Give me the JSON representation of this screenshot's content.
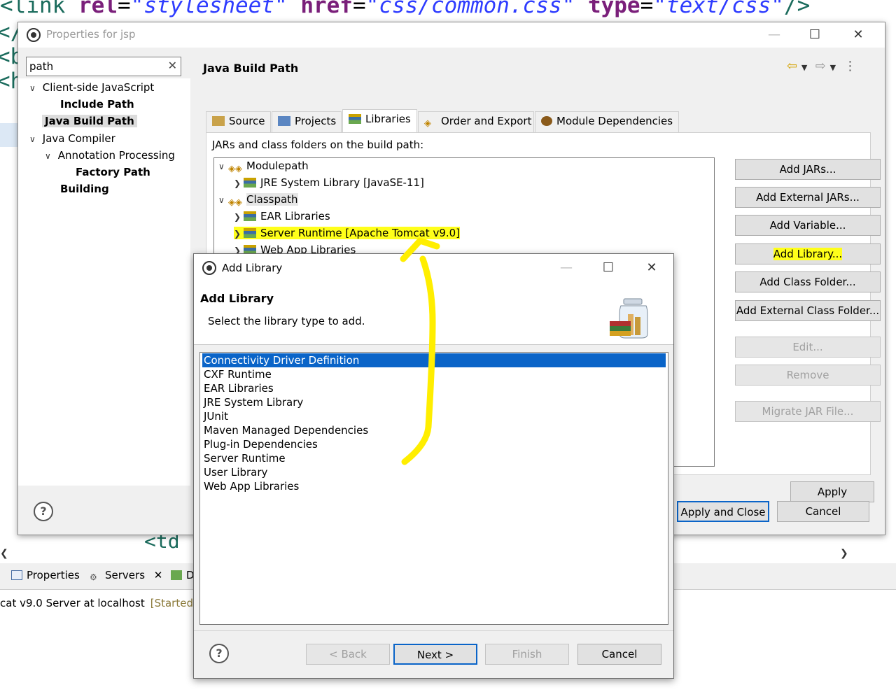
{
  "editor": {
    "code_parts": [
      "<",
      "link",
      " ",
      "rel",
      "=",
      "\"stylesheet\"",
      " ",
      "href",
      "=",
      "\"css/common.css\"",
      " ",
      "type",
      "=",
      "\"text/css\"",
      "/>"
    ],
    "left_glyphs": [
      "</",
      "<b",
      "<h"
    ],
    "td_fragment": "<td"
  },
  "properties_window": {
    "title": "Properties for jsp",
    "filter_value": "path",
    "left_tree": [
      {
        "label": "Client-side JavaScript",
        "expanded": true
      },
      {
        "label": "Include Path"
      },
      {
        "label": "Java Build Path",
        "selected": true
      },
      {
        "label": "Java Compiler",
        "expanded": true
      },
      {
        "label": "Annotation Processing",
        "expanded": true
      },
      {
        "label": "Factory Path"
      },
      {
        "label": "Building"
      }
    ],
    "page_title": "Java Build Path",
    "tabs": [
      {
        "label": "Source"
      },
      {
        "label": "Projects"
      },
      {
        "label": "Libraries",
        "active": true
      },
      {
        "label": "Order and Export"
      },
      {
        "label": "Module Dependencies"
      }
    ],
    "jars_label": "JARs and class folders on the build path:",
    "build_tree": [
      {
        "label": "Modulepath"
      },
      {
        "label": "JRE System Library [JavaSE-11]"
      },
      {
        "label": "Classpath"
      },
      {
        "label": "EAR Libraries"
      },
      {
        "label": "Server Runtime [Apache Tomcat v9.0]",
        "highlighted": true
      },
      {
        "label": "Web App Libraries"
      }
    ],
    "side_buttons": [
      {
        "label": "Add JARs...",
        "enabled": true
      },
      {
        "label": "Add External JARs...",
        "enabled": true
      },
      {
        "label": "Add Variable...",
        "enabled": true
      },
      {
        "label": "Add Library...",
        "enabled": true,
        "highlighted": true
      },
      {
        "label": "Add Class Folder...",
        "enabled": true
      },
      {
        "label": "Add External Class Folder...",
        "enabled": true
      },
      {
        "label": "Edit...",
        "enabled": false
      },
      {
        "label": "Remove",
        "enabled": false
      },
      {
        "label": "Migrate JAR File...",
        "enabled": false
      }
    ],
    "apply_label": "Apply",
    "apply_close_label": "Apply and Close",
    "cancel_label": "Cancel"
  },
  "add_library": {
    "title": "Add Library",
    "heading": "Add Library",
    "description": "Select the library type to add.",
    "items": [
      "Connectivity Driver Definition",
      "CXF Runtime",
      "EAR Libraries",
      "JRE System Library",
      "JUnit",
      "Maven Managed Dependencies",
      "Plug-in Dependencies",
      "Server Runtime",
      "User Library",
      "Web App Libraries"
    ],
    "selected_index": 0,
    "buttons": {
      "back": "< Back",
      "next": "Next >",
      "finish": "Finish",
      "cancel": "Cancel"
    }
  },
  "bottom_panel": {
    "tabs": [
      {
        "label": "Properties"
      },
      {
        "label": "Servers"
      },
      {
        "label": "D"
      }
    ],
    "server_name": "cat v9.0 Server at localhost",
    "server_status": "[Started, S"
  },
  "colors": {
    "highlight": "#ffff1a",
    "selection": "#0a64c8",
    "annotation_arrow": "#ffee00"
  }
}
